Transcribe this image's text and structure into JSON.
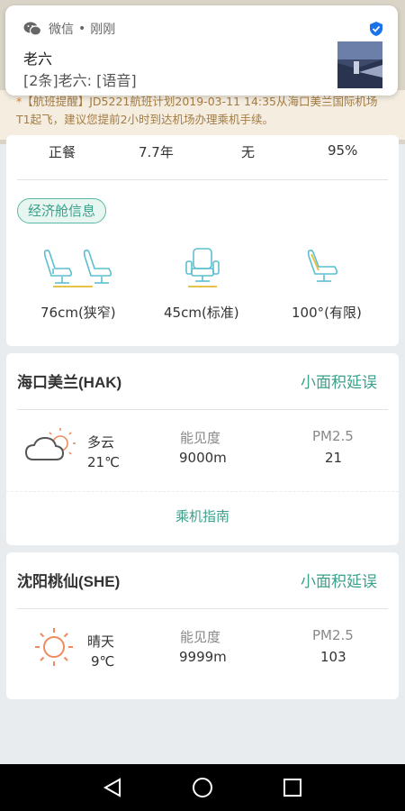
{
  "notification": {
    "app_name": "微信",
    "separator": "•",
    "time": "刚刚",
    "sender": "老六",
    "message": "[2条]老六: [语音]"
  },
  "tip": {
    "star": "*",
    "text": "【航班提醒】JD5221航班计划2019-03-11 14:35从海口美兰国际机场T1起飞，建议您提前2小时到达机场办理乘机手续。"
  },
  "stats": [
    "正餐",
    "7.7年",
    "无",
    "95%"
  ],
  "cabin": {
    "tag": "经济舱信息",
    "seats": [
      {
        "label": "76cm(狭窄)",
        "icon": "seat-pitch-icon"
      },
      {
        "label": "45cm(标准)",
        "icon": "seat-width-icon"
      },
      {
        "label": "100°(有限)",
        "icon": "seat-recline-icon"
      }
    ]
  },
  "airports": [
    {
      "name": "海口美兰(HAK)",
      "status": "小面积延误",
      "weather_icon": "partly-cloudy-icon",
      "weather": "多云",
      "temp": "21℃",
      "visibility_label": "能见度",
      "visibility": "9000m",
      "pm_label": "PM2.5",
      "pm": "21",
      "guide": "乘机指南"
    },
    {
      "name": "沈阳桃仙(SHE)",
      "status": "小面积延误",
      "weather_icon": "sunny-icon",
      "weather": "晴天",
      "temp": "9℃",
      "visibility_label": "能见度",
      "visibility": "9999m",
      "pm_label": "PM2.5",
      "pm": "103"
    }
  ],
  "colors": {
    "accent": "#3aa08b",
    "tip_text": "#a47c43",
    "tip_bg": "#f4ede0",
    "sun": "#f08a5d"
  },
  "navbar": {
    "icons": [
      "back-icon",
      "home-icon",
      "recents-icon"
    ]
  }
}
